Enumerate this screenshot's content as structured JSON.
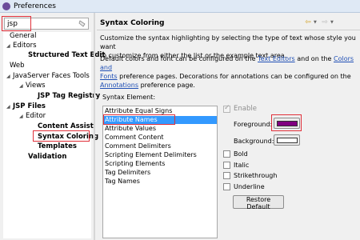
{
  "window": {
    "title": "Preferences"
  },
  "filter": {
    "value": "jsp"
  },
  "tree": {
    "items": [
      {
        "label": "General"
      },
      {
        "label": "Editors"
      },
      {
        "label": "Structured Text Edit"
      },
      {
        "label": "Web"
      },
      {
        "label": "JavaServer Faces Tools"
      },
      {
        "label": "Views"
      },
      {
        "label": "JSP Tag Registry"
      },
      {
        "label": "JSP Files"
      },
      {
        "label": "Editor"
      },
      {
        "label": "Content Assist"
      },
      {
        "label": "Syntax Coloring"
      },
      {
        "label": "Templates"
      },
      {
        "label": "Validation"
      }
    ]
  },
  "page": {
    "title": "Syntax Coloring",
    "desc1_line1": "Customize the syntax highlighting by selecting the type of text whose style you want",
    "desc1_line2": "to customize from either the list or the example text area.",
    "desc2_a": "Default colors and font can be configured on the ",
    "desc2_link1": "Text Editors",
    "desc2_b": " and on the ",
    "desc2_link2": "Colors and",
    "desc2_link3": "Fonts",
    "desc2_c": " preference pages.  Decorations for annotations can be configured on the",
    "desc2_link4": "Annotations",
    "desc2_d": " preference page.",
    "syntax_label": "Syntax Element:",
    "elements": [
      "Attribute Equal Signs",
      "Attribute Names",
      "Attribute Values",
      "Comment Content",
      "Comment Delimiters",
      "Scripting Element Delimiters",
      "Scripting Elements",
      "Tag Delimiters",
      "Tag Names"
    ],
    "enable_label": "Enable",
    "foreground_label": "Foreground:",
    "background_label": "Background:",
    "bold_label": "Bold",
    "italic_label": "Italic",
    "strikethrough_label": "Strikethrough",
    "underline_label": "Underline",
    "restore_label": "Restore Default"
  },
  "colors": {
    "foreground": "#800080",
    "background": "#ffffff",
    "selection": "#3399ff",
    "highlight": "#e0303a",
    "link": "#1f4fb5"
  },
  "state": {
    "selected_element": "Attribute Names",
    "enable_checked": true,
    "enable_disabled": true
  }
}
